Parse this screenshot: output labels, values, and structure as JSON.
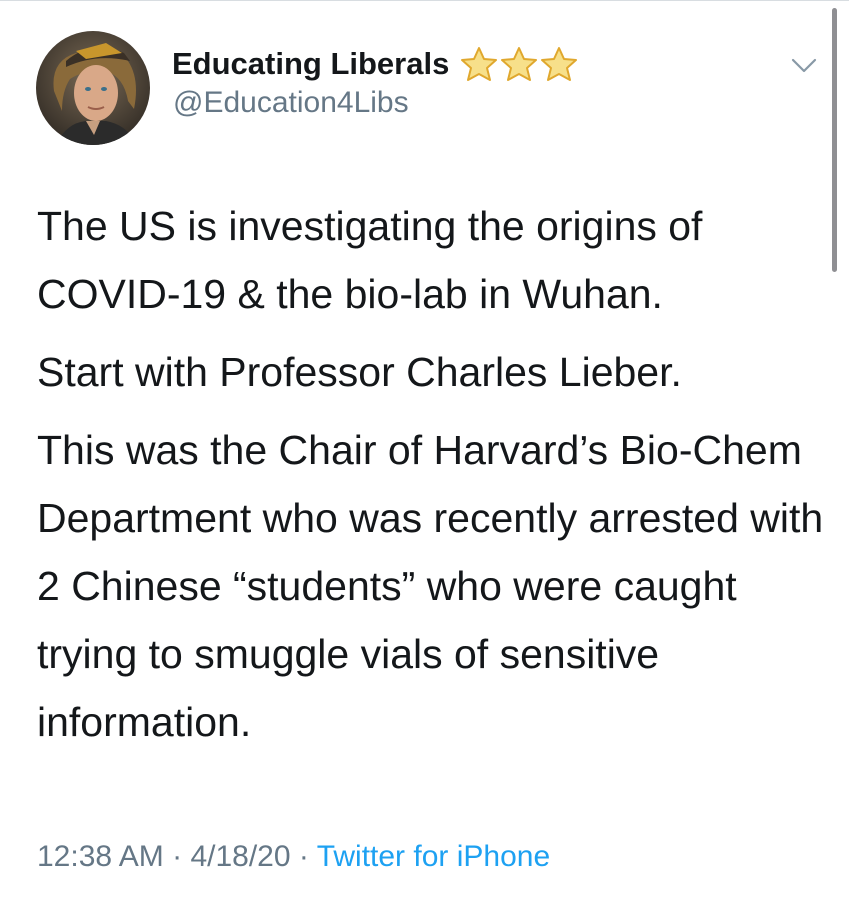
{
  "account": {
    "display_name": "Educating Liberals",
    "handle": "@Education4Libs",
    "badges": [
      "star-icon",
      "star-icon",
      "star-icon"
    ]
  },
  "tweet": {
    "paragraphs": [
      "The US is investigating the origins of COVID-19 & the bio-lab in Wuhan.",
      "Start with Professor Charles Lieber.",
      "This was the Chair of Harvard’s Bio-Chem Department who was recently arrested with 2 Chinese “students” who were caught trying to smuggle vials of sensitive information."
    ],
    "time": "12:38 AM",
    "separator": "·",
    "date": "4/18/20",
    "source": "Twitter for iPhone"
  },
  "colors": {
    "text": "#14171a",
    "secondary": "#657786",
    "link": "#1da1f2",
    "star_fill": "#f7e08a",
    "star_stroke": "#e0a82e"
  }
}
